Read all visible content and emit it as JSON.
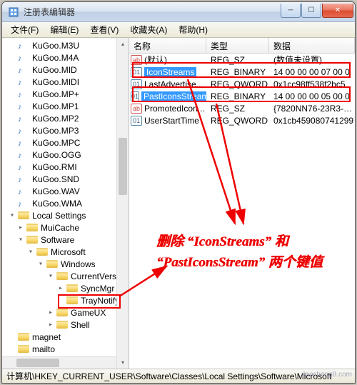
{
  "window": {
    "title": "注册表编辑器"
  },
  "menu": {
    "file": "文件(F)",
    "edit": "编辑(E)",
    "view": "查看(V)",
    "favorites": "收藏夹(A)",
    "help": "帮助(H)"
  },
  "tree": {
    "items": [
      {
        "label": "KuGoo.M3U",
        "icon": "music",
        "indent": 0,
        "exp": ""
      },
      {
        "label": "KuGoo.M4A",
        "icon": "music",
        "indent": 0,
        "exp": ""
      },
      {
        "label": "KuGoo.MID",
        "icon": "music",
        "indent": 0,
        "exp": ""
      },
      {
        "label": "KuGoo.MIDI",
        "icon": "music",
        "indent": 0,
        "exp": ""
      },
      {
        "label": "KuGoo.MP+",
        "icon": "music",
        "indent": 0,
        "exp": ""
      },
      {
        "label": "KuGoo.MP1",
        "icon": "music",
        "indent": 0,
        "exp": ""
      },
      {
        "label": "KuGoo.MP2",
        "icon": "music",
        "indent": 0,
        "exp": ""
      },
      {
        "label": "KuGoo.MP3",
        "icon": "music",
        "indent": 0,
        "exp": ""
      },
      {
        "label": "KuGoo.MPC",
        "icon": "music",
        "indent": 0,
        "exp": ""
      },
      {
        "label": "KuGoo.OGG",
        "icon": "music",
        "indent": 0,
        "exp": ""
      },
      {
        "label": "KuGoo.RMI",
        "icon": "music",
        "indent": 0,
        "exp": ""
      },
      {
        "label": "KuGoo.SND",
        "icon": "music",
        "indent": 0,
        "exp": ""
      },
      {
        "label": "KuGoo.WAV",
        "icon": "music",
        "indent": 0,
        "exp": ""
      },
      {
        "label": "KuGoo.WMA",
        "icon": "music",
        "indent": 0,
        "exp": ""
      },
      {
        "label": "Local Settings",
        "icon": "folder",
        "indent": 0,
        "exp": "▾"
      },
      {
        "label": "MuiCache",
        "icon": "folder",
        "indent": 1,
        "exp": "▸"
      },
      {
        "label": "Software",
        "icon": "folder",
        "indent": 1,
        "exp": "▾"
      },
      {
        "label": "Microsoft",
        "icon": "folder",
        "indent": 2,
        "exp": "▾"
      },
      {
        "label": "Windows",
        "icon": "folder",
        "indent": 3,
        "exp": "▾"
      },
      {
        "label": "CurrentVersion",
        "icon": "folder",
        "indent": 4,
        "exp": "▾"
      },
      {
        "label": "SyncMgr",
        "icon": "folder",
        "indent": 5,
        "exp": "▸"
      },
      {
        "label": "TrayNotify",
        "icon": "folder",
        "indent": 5,
        "exp": ""
      },
      {
        "label": "GameUX",
        "icon": "folder",
        "indent": 4,
        "exp": "▸"
      },
      {
        "label": "Shell",
        "icon": "folder",
        "indent": 4,
        "exp": "▸"
      },
      {
        "label": "magnet",
        "icon": "folder",
        "indent": 0,
        "exp": ""
      },
      {
        "label": "mailto",
        "icon": "folder",
        "indent": 0,
        "exp": ""
      }
    ]
  },
  "list": {
    "headers": {
      "name": "名称",
      "type": "类型",
      "data": "数据"
    },
    "rows": [
      {
        "icon": "str",
        "iconText": "ab",
        "name": "(默认)",
        "type": "REG_SZ",
        "data": "(数值未设置)",
        "selected": false
      },
      {
        "icon": "bin",
        "iconText": "01",
        "name": "IconStreams",
        "type": "REG_BINARY",
        "data": "14 00 00 00 07 00 0",
        "selected": true
      },
      {
        "icon": "bin",
        "iconText": "01",
        "name": "LastAdvertise...",
        "type": "REG_QWORD",
        "data": "0x1cc98ff538f2bc5",
        "selected": false
      },
      {
        "icon": "bin",
        "iconText": "01",
        "name": "PastIconsStream",
        "type": "REG_BINARY",
        "data": "14 00 00 00 05 00 0",
        "selected": true
      },
      {
        "icon": "str",
        "iconText": "ab",
        "name": "PromotedIcon...",
        "type": "REG_SZ",
        "data": "{7820NN76-23R3-4...",
        "selected": false
      },
      {
        "icon": "bin",
        "iconText": "01",
        "name": "UserStartTime",
        "type": "REG_QWORD",
        "data": "0x1cb459080741299",
        "selected": false
      }
    ]
  },
  "statusbar": {
    "path": "计算机\\HKEY_CURRENT_USER\\Software\\Classes\\Local Settings\\Software\\Microsoft"
  },
  "annotation": {
    "text": "删除 “IconStreams” 和 “PastIconsStream” 两个键值"
  },
  "watermark": "jiaocheng8.com"
}
